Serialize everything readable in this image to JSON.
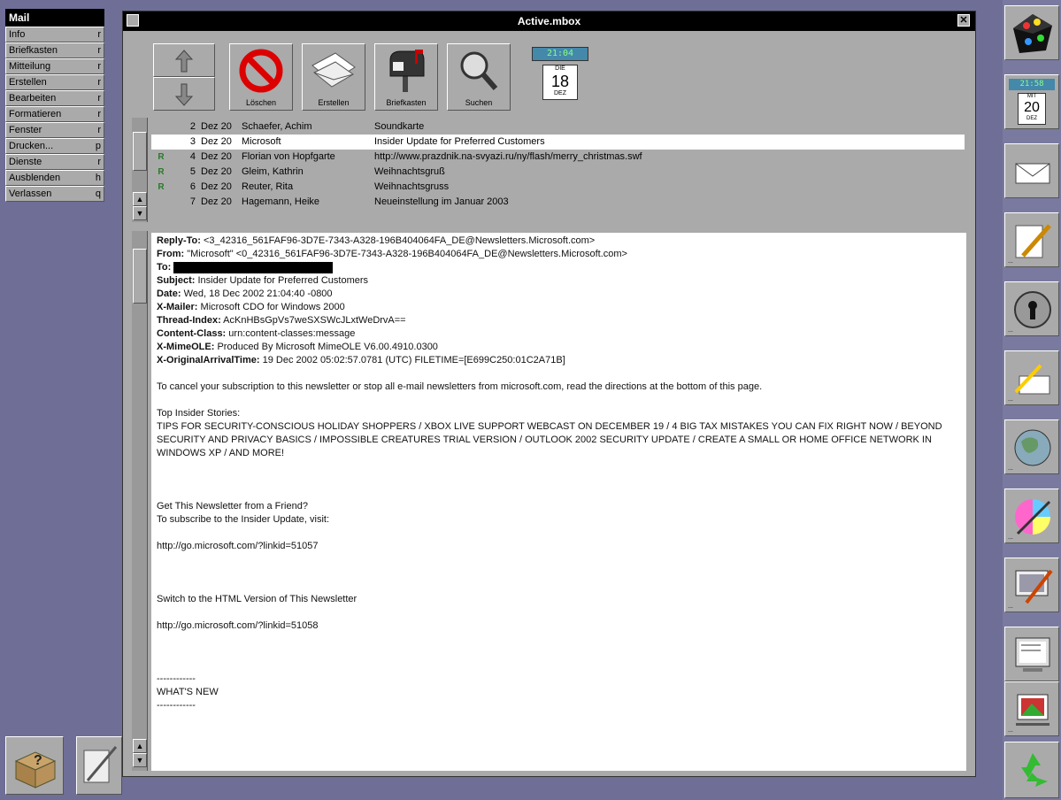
{
  "menu": {
    "title": "Mail",
    "items": [
      {
        "label": "Info",
        "key": "r"
      },
      {
        "label": "Briefkasten",
        "key": "r"
      },
      {
        "label": "Mitteilung",
        "key": "r"
      },
      {
        "label": "Erstellen",
        "key": "r"
      },
      {
        "label": "Bearbeiten",
        "key": "r"
      },
      {
        "label": "Formatieren",
        "key": "r"
      },
      {
        "label": "Fenster",
        "key": "r"
      },
      {
        "label": "Drucken...",
        "key": "p"
      },
      {
        "label": "Dienste",
        "key": "r"
      },
      {
        "label": "Ausblenden",
        "key": "h"
      },
      {
        "label": "Verlassen",
        "key": "q"
      }
    ]
  },
  "window": {
    "title": "Active.mbox",
    "close_glyph": "✕"
  },
  "toolbar": {
    "delete_label": "Löschen",
    "compose_label": "Erstellen",
    "mailbox_label": "Briefkasten",
    "search_label": "Suchen",
    "clock_time": "21:04",
    "cal_weekday": "DIE",
    "cal_day": "18",
    "cal_month": "DEZ"
  },
  "messages": [
    {
      "status": "",
      "num": "2",
      "date": "Dez 20",
      "from": "Schaefer, Achim",
      "subject": "Soundkarte",
      "selected": false
    },
    {
      "status": "",
      "num": "3",
      "date": "Dez 20",
      "from": "Microsoft",
      "subject": "Insider Update for Preferred Customers",
      "selected": true
    },
    {
      "status": "R",
      "num": "4",
      "date": "Dez 20",
      "from": "Florian von Hopfgarte",
      "subject": "http://www.prazdnik.na-svyazi.ru/ny/flash/merry_christmas.swf",
      "selected": false
    },
    {
      "status": "R",
      "num": "5",
      "date": "Dez 20",
      "from": "Gleim, Kathrin",
      "subject": "Weihnachtsgruß",
      "selected": false
    },
    {
      "status": "R",
      "num": "6",
      "date": "Dez 20",
      "from": "Reuter, Rita",
      "subject": "Weihnachtsgruss",
      "selected": false
    },
    {
      "status": "",
      "num": "7",
      "date": "Dez 20",
      "from": "Hagemann, Heike",
      "subject": "Neueinstellung im Januar 2003",
      "selected": false
    }
  ],
  "message": {
    "headers": [
      {
        "key": "Reply-To:",
        "value": " <3_42316_561FAF96-3D7E-7343-A328-196B404064FA_DE@Newsletters.Microsoft.com>"
      },
      {
        "key": "From:",
        "value": " \"Microsoft\" <0_42316_561FAF96-3D7E-7343-A328-196B404064FA_DE@Newsletters.Microsoft.com>"
      },
      {
        "key": "To:",
        "value": ""
      },
      {
        "key": "Subject:",
        "value": " Insider Update for Preferred Customers"
      },
      {
        "key": "Date:",
        "value": " Wed, 18 Dec 2002 21:04:40 -0800"
      },
      {
        "key": "X-Mailer:",
        "value": " Microsoft CDO for Windows 2000"
      },
      {
        "key": "Thread-Index:",
        "value": " AcKnHBsGpVs7weSXSWcJLxtWeDrvA=="
      },
      {
        "key": "Content-Class:",
        "value": " urn:content-classes:message"
      },
      {
        "key": "X-MimeOLE:",
        "value": " Produced By Microsoft MimeOLE V6.00.4910.0300"
      },
      {
        "key": "X-OriginalArrivalTime:",
        "value": " 19 Dec 2002 05:02:57.0781 (UTC) FILETIME=[E699C250:01C2A71B]"
      }
    ],
    "p1": "To cancel your subscription to this newsletter or stop all e-mail newsletters from microsoft.com, read the directions at the bottom of this page.",
    "p2_title": "Top Insider Stories:",
    "p2_body": "TIPS FOR SECURITY-CONSCIOUS HOLIDAY SHOPPERS / XBOX LIVE SUPPORT WEBCAST ON DECEMBER 19 / 4 BIG TAX MISTAKES YOU CAN FIX RIGHT NOW / BEYOND SECURITY AND PRIVACY BASICS / IMPOSSIBLE CREATURES TRIAL VERSION / OUTLOOK 2002 SECURITY UPDATE / CREATE A SMALL OR HOME OFFICE NETWORK IN WINDOWS XP / AND MORE!",
    "p3_title": "Get This Newsletter from a Friend?",
    "p3_body": "To subscribe to the Insider Update, visit:",
    "link1": "http://go.microsoft.com/?linkid=51057",
    "p4": "Switch to the HTML Version of This Newsletter",
    "link2": "http://go.microsoft.com/?linkid=51058",
    "sep1": "------------",
    "whatsnew": "WHAT'S NEW",
    "sep2": "------------"
  },
  "dock": {
    "clock_time": "21:58",
    "cal_weekday": "MIT",
    "cal_day": "20",
    "cal_month": "DEZ"
  }
}
